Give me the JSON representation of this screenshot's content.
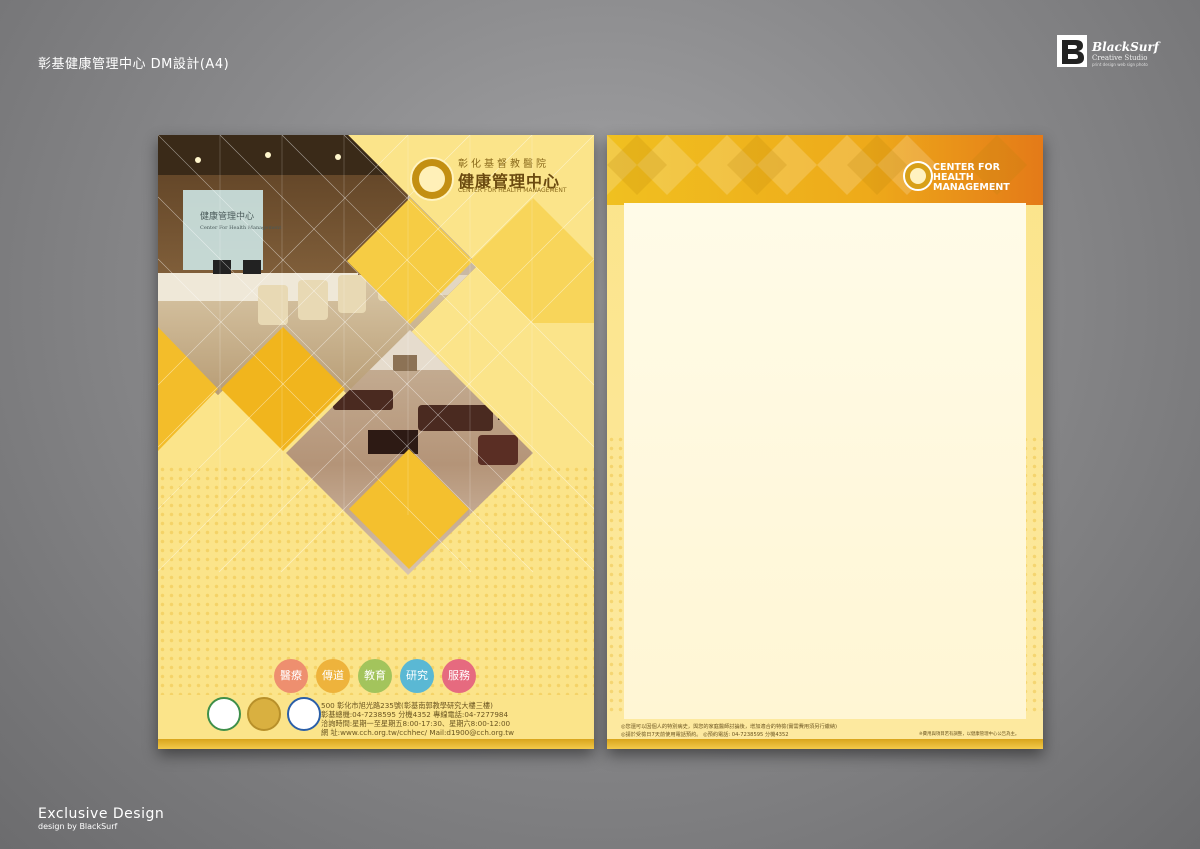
{
  "page": {
    "title": "彰基健康管理中心  DM設計(A4)",
    "brand": {
      "name": "BlackSurf",
      "sub": "Creative Studio",
      "tagline": "print design web sign photo"
    },
    "footer": {
      "title": "Exclusive Design",
      "sub": "design by BlackSurf"
    }
  },
  "front": {
    "hospital": "彰化基督教醫院",
    "center_zh": "健康管理中心",
    "center_en": "CENTER FOR HEALTH MANAGEMENT",
    "sign_zh": "健康管理中心",
    "sign_en": "Center For Health Management",
    "tags": [
      {
        "label": "醫療",
        "color": "#ee8f6f"
      },
      {
        "label": "傳道",
        "color": "#eeb33c"
      },
      {
        "label": "教育",
        "color": "#a3c45c"
      },
      {
        "label": "研究",
        "color": "#5ab8d4"
      },
      {
        "label": "服務",
        "color": "#e66a7f"
      }
    ],
    "address": [
      "500 彰化市旭光路235號(彰基南郭教學研究大樓三樓)",
      "彰基總機:04-7238595 分機4352    專線電話:04-7277984",
      "洽詢時間:星期一至星期五8:00-17:30、星期六8:00-12:00",
      "網   址:www.cch.org.tw/cchhec/     Mail:d1900@cch.org.tw"
    ]
  },
  "back": {
    "center_en": "CENTER FOR HEALTH MANAGEMENT",
    "notes": [
      "◎您還可以因個人的特別病史，與您的家庭醫師討論後，增加適合的特檢(實需費用須另行繳納)",
      "◎請於受檢日7天前使用電話預約。     ◎預約電話: 04-7238595  分機4352"
    ],
    "disclaimer": "※費用與項目若有調整，以健康管理中心公告為主。"
  },
  "colors": {
    "background": "#8a8a8c",
    "paper": "#fbe48a",
    "accent": "#f1b51d",
    "gold": "#d9a51c"
  }
}
